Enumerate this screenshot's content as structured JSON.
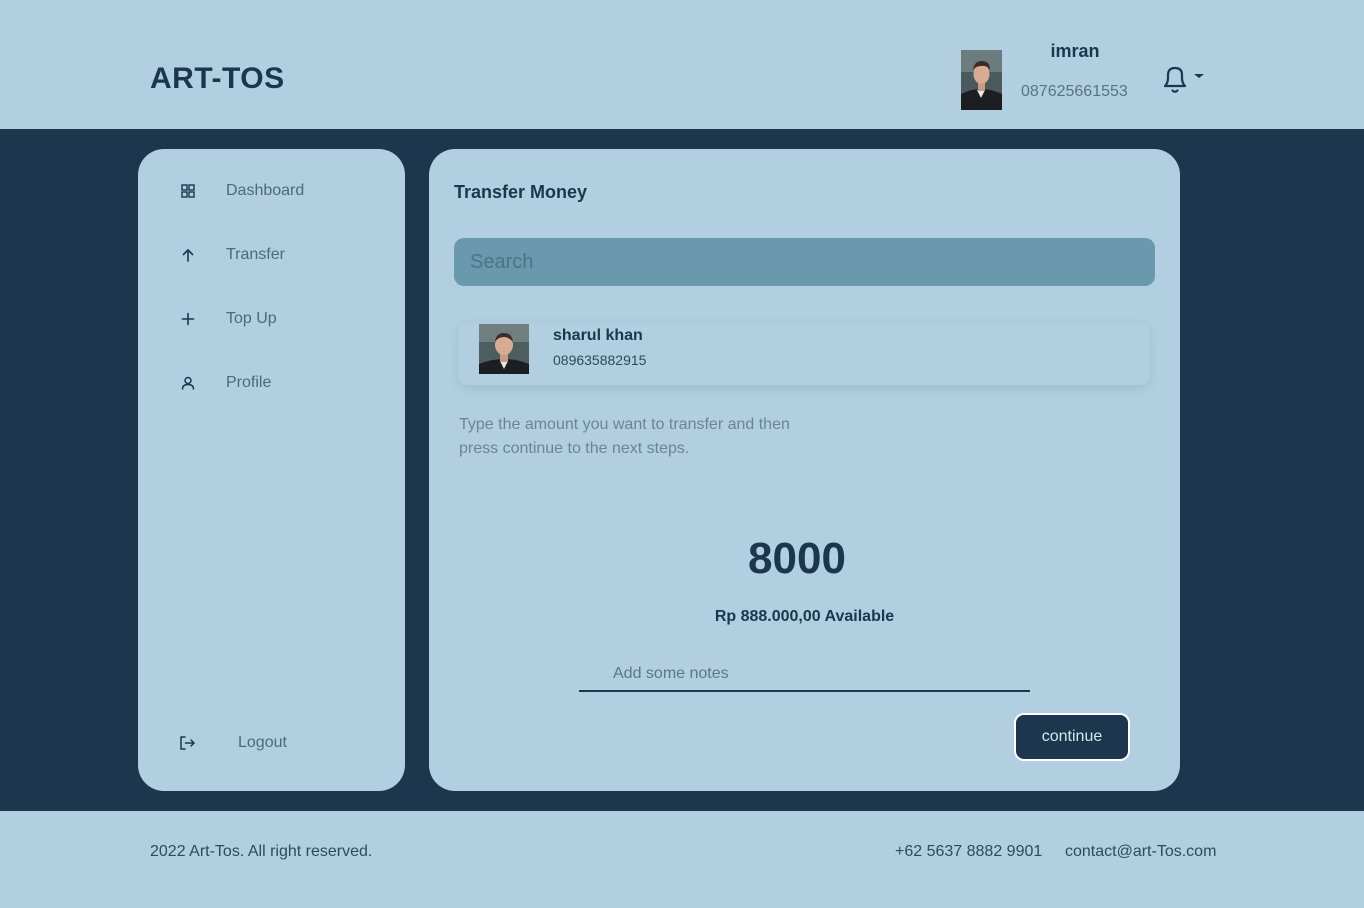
{
  "header": {
    "brand": "ART-TOS",
    "user": {
      "name": "imran",
      "phone": "087625661553"
    },
    "icons": {
      "notifications": "bell-icon",
      "dropdown": "caret-down-icon"
    }
  },
  "sidebar": {
    "items": [
      {
        "label": "Dashboard",
        "icon": "grid-icon"
      },
      {
        "label": "Transfer",
        "icon": "arrow-up-icon"
      },
      {
        "label": "Top Up",
        "icon": "plus-icon"
      },
      {
        "label": "Profile",
        "icon": "user-icon"
      }
    ],
    "logout": {
      "label": "Logout",
      "icon": "logout-icon"
    }
  },
  "main": {
    "title": "Transfer Money",
    "search": {
      "placeholder": "Search",
      "value": ""
    },
    "recipient": {
      "name": "sharul khan",
      "phone": "089635882915"
    },
    "hint": "Type the amount you want to transfer and then press continue to the next steps.",
    "amount": "8000",
    "balance": "Rp 888.000,00 Available",
    "notes": {
      "placeholder": "Add some notes",
      "value": ""
    },
    "continue_label": "continue"
  },
  "footer": {
    "copyright": "2022 Art-Tos. All right reserved.",
    "phone": "+62 5637 8882 9901",
    "email": "contact@art-Tos.com"
  },
  "colors": {
    "background": "#b1cfe0",
    "primary": "#1c364d",
    "search_bg": "#6a98ac",
    "muted_text": "#6d8493"
  }
}
